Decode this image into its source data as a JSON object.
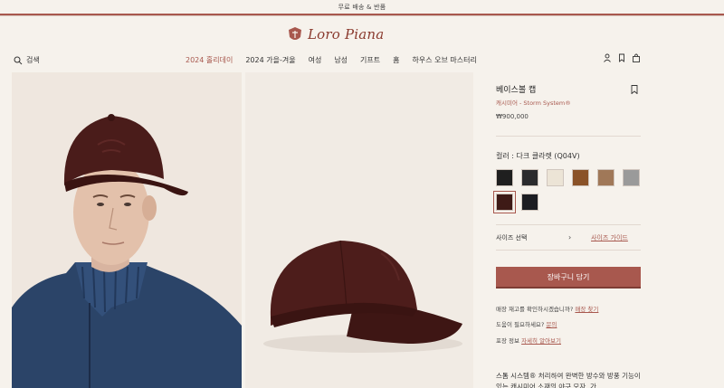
{
  "topbar": {
    "text": "무료 배송 & 반품"
  },
  "logo": {
    "text": "Loro Piana"
  },
  "search": {
    "label": "검색"
  },
  "nav": {
    "items": [
      {
        "label": "2024 홀리데이",
        "active": true
      },
      {
        "label": "2024 가을-겨울",
        "active": false
      },
      {
        "label": "여성",
        "active": false
      },
      {
        "label": "남성",
        "active": false
      },
      {
        "label": "기프트",
        "active": false
      },
      {
        "label": "홈",
        "active": false
      },
      {
        "label": "하우스 오브 마스터리",
        "active": false
      }
    ]
  },
  "product": {
    "title": "베이스볼 캡",
    "subtitle": "캐시미어 - Storm System®",
    "price": "₩900,000",
    "color_label": "컬러 : 다크 클라렛 (Q04V)",
    "swatches": [
      {
        "name": "black",
        "color": "#1f1f1f"
      },
      {
        "name": "charcoal",
        "color": "#2b2b2d"
      },
      {
        "name": "cream",
        "color": "#ece4d6"
      },
      {
        "name": "cognac",
        "color": "#8a5228"
      },
      {
        "name": "camel",
        "color": "#a07858"
      },
      {
        "name": "grey",
        "color": "#9a9a9a"
      },
      {
        "name": "dark-claret",
        "color": "#3e1a16",
        "selected": true
      },
      {
        "name": "navy-black",
        "color": "#1c1d22"
      }
    ],
    "size_label": "사이즈 선택",
    "size_guide": "사이즈 가이드",
    "cart_button": "장바구니 담기",
    "store_text": "매장 재고를 확인하시겠습니까?",
    "store_link": "매장 찾기",
    "help_text": "도움이 필요하세요?",
    "help_link": "문의",
    "packaging_text": "포장 정보",
    "packaging_link": "자세히 알아보기",
    "description": "스톰 시스템® 처리하여 완벽한 방수와 방풍 기능이 있는 캐시미어 소재의 야구 모자. 가"
  },
  "colors": {
    "accent": "#a8584e",
    "background": "#f6f2ec"
  }
}
